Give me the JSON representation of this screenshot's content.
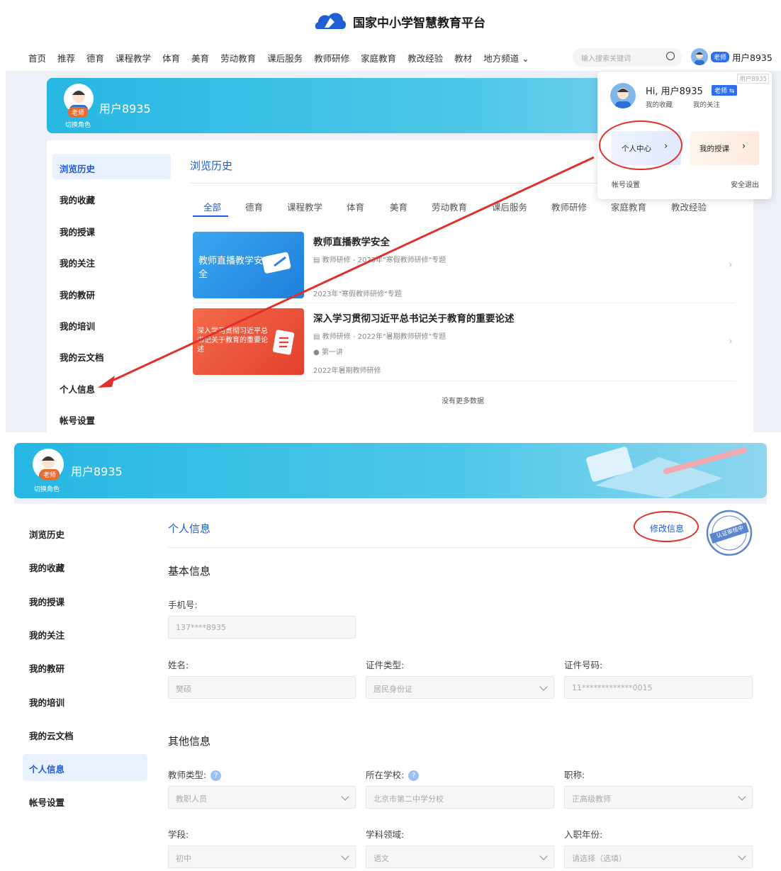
{
  "header": {
    "logo_text": "国家中小学智慧教育平台"
  },
  "nav": {
    "items": [
      "首页",
      "推荐",
      "德育",
      "课程教学",
      "体育",
      "美育",
      "劳动教育",
      "课后服务",
      "教师研修",
      "家庭教育",
      "教改经验",
      "教材",
      "地方频道 ⌄"
    ],
    "search_placeholder": "输入搜索关键词",
    "user_badge": "老师",
    "user_name": "用户8935"
  },
  "dropdown": {
    "corner_label": "用户8935",
    "greeting": "Hi, 用户8935",
    "badge": "老师 ⇆",
    "links": [
      "我的收藏",
      "我的关注"
    ],
    "personal_center": "个人中心",
    "my_lessons": "我的授课",
    "account_settings": "帐号设置",
    "logout": "安全退出"
  },
  "profile": {
    "name": "用户8935",
    "badge": "老师",
    "switch_role": "切换角色"
  },
  "sidebar": {
    "items": [
      "浏览历史",
      "我的收藏",
      "我的授课",
      "我的关注",
      "我的教研",
      "我的培训",
      "我的云文档",
      "个人信息",
      "帐号设置"
    ]
  },
  "history": {
    "title": "浏览历史",
    "tabs": [
      "全部",
      "德育",
      "课程教学",
      "体育",
      "美育",
      "劳动教育",
      "课后服务",
      "教师研修",
      "家庭教育",
      "教改经验"
    ],
    "cards": [
      {
        "thumb": "教师直播教学安全",
        "title": "教师直播教学安全",
        "meta": "教师研修 - 2023年\"寒假教师研修\"专题",
        "extra": "",
        "footer": "2023年\"寒假教师研修\"专题"
      },
      {
        "thumb": "深入学习贯彻习近平总书记关于教育的重要论述",
        "title": "深入学习贯彻习近平总书记关于教育的重要论述",
        "meta": "教师研修 - 2022年\"暑期教师研修\"专题",
        "extra": "第一讲",
        "footer": "2022年暑期教师研修"
      }
    ],
    "no_more": "没有更多数据"
  },
  "personal_info": {
    "title": "个人信息",
    "edit_link": "修改信息",
    "stamp_text": "认证审核中",
    "basic_heading": "基本信息",
    "phone_label": "手机号:",
    "phone_value": "137****8935",
    "name_label": "姓名:",
    "name_value": "樊硕",
    "id_type_label": "证件类型:",
    "id_type_value": "居民身份证",
    "id_no_label": "证件号码:",
    "id_no_value": "11*************0015",
    "other_heading": "其他信息",
    "teacher_type_label": "教师类型:",
    "teacher_type_value": "教职人员",
    "school_label": "所在学校:",
    "school_value": "北京市第二中学分校",
    "title_label": "职称:",
    "title_value": "正高级教师",
    "stage_label": "学段:",
    "stage_value": "初中",
    "subject_label": "学科领域:",
    "subject_value": "语文",
    "year_label": "入职年份:",
    "year_value": "请选择（选填）"
  },
  "colors": {
    "accent": "#1d5bd8",
    "banner": "#26b7e2",
    "annotation": "#e0302a"
  }
}
